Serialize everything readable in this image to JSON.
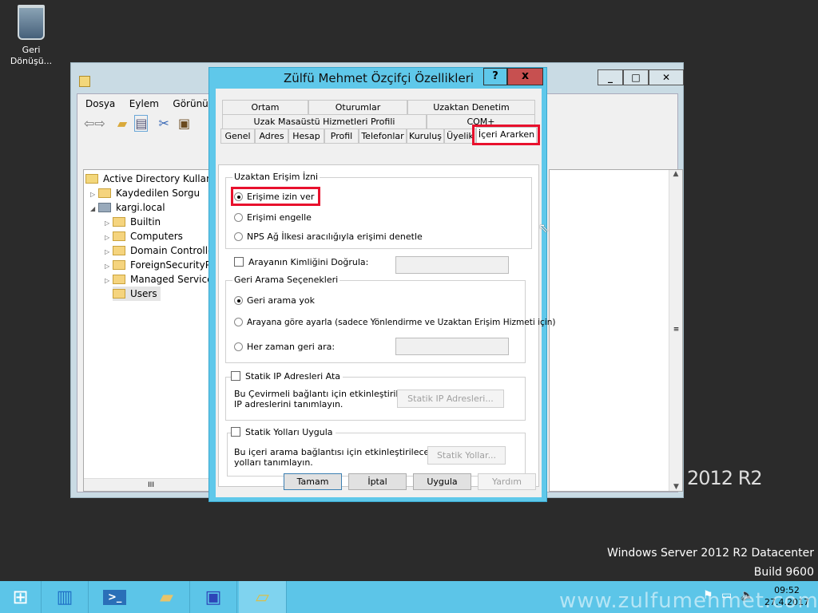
{
  "desktop": {
    "recycle_bin": "Geri Dönüşü...",
    "brand_text": "2012 R2",
    "os_line1": "Windows Server 2012 R2 Datacenter",
    "os_line2": "Build 9600",
    "watermark": "www.zulfumehmet.com"
  },
  "aduc": {
    "menu": [
      "Dosya",
      "Eylem",
      "Görünüm"
    ],
    "tree": [
      {
        "label": "Active Directory Kullanıcıla",
        "expander": ""
      },
      {
        "label": "Kaydedilen Sorgu",
        "expander": "▷"
      },
      {
        "label": "kargi.local",
        "expander": "◢"
      },
      {
        "label": "Builtin",
        "expander": "▷"
      },
      {
        "label": "Computers",
        "expander": "▷"
      },
      {
        "label": "Domain Controllers",
        "expander": "▷"
      },
      {
        "label": "ForeignSecurityPrin",
        "expander": "▷"
      },
      {
        "label": "Managed Service A",
        "expander": "▷"
      },
      {
        "label": "Users",
        "expander": ""
      }
    ],
    "hscroll_label": "III"
  },
  "dialog": {
    "title": "Zülfü Mehmet Özçifçi Özellikleri",
    "help": "?",
    "close": "x",
    "tabs_row1": [
      "Ortam",
      "Oturumlar",
      "Uzaktan Denetim"
    ],
    "tabs_row2": [
      "Uzak Masaüstü Hizmetleri Profili",
      "COM+"
    ],
    "tabs_row3": [
      "Genel",
      "Adres",
      "Hesap",
      "Profil",
      "Telefonlar",
      "Kuruluş",
      "Üyelik",
      "İçeri Ararken"
    ],
    "remote_access": {
      "legend": "Uzaktan Erişim İzni",
      "options": [
        "Erişime izin ver",
        "Erişimi engelle",
        "NPS Ağ İlkesi aracılığıyla erişimi denetle"
      ],
      "selected": 0
    },
    "verify_caller": {
      "label": "Arayanın Kimliğini Doğrula:",
      "checked": false,
      "value": ""
    },
    "callback": {
      "legend": "Geri Arama Seçenekleri",
      "options": [
        "Geri arama yok",
        "Arayana göre ayarla (sadece Yönlendirme ve Uzaktan Erişim Hizmeti için)",
        "Her zaman geri ara:"
      ],
      "selected": 0,
      "value": ""
    },
    "static_ip": {
      "label": "Statik IP Adresleri Ata",
      "checked": false,
      "desc1": "Bu Çevirmeli bağlantı için etkinleştirilecek",
      "desc2": "IP adreslerini tanımlayın.",
      "button": "Statik IP Adresleri..."
    },
    "static_routes": {
      "label": "Statik Yolları Uygula",
      "checked": false,
      "desc1": "Bu içeri arama bağlantısı için etkinleştirilecek",
      "desc2": "yolları tanımlayın.",
      "button": "Statik Yollar..."
    },
    "buttons": {
      "ok": "Tamam",
      "cancel": "İptal",
      "apply": "Uygula",
      "help": "Yardım"
    }
  },
  "tray": {
    "time": "09:52",
    "date": "27.4.2017"
  }
}
